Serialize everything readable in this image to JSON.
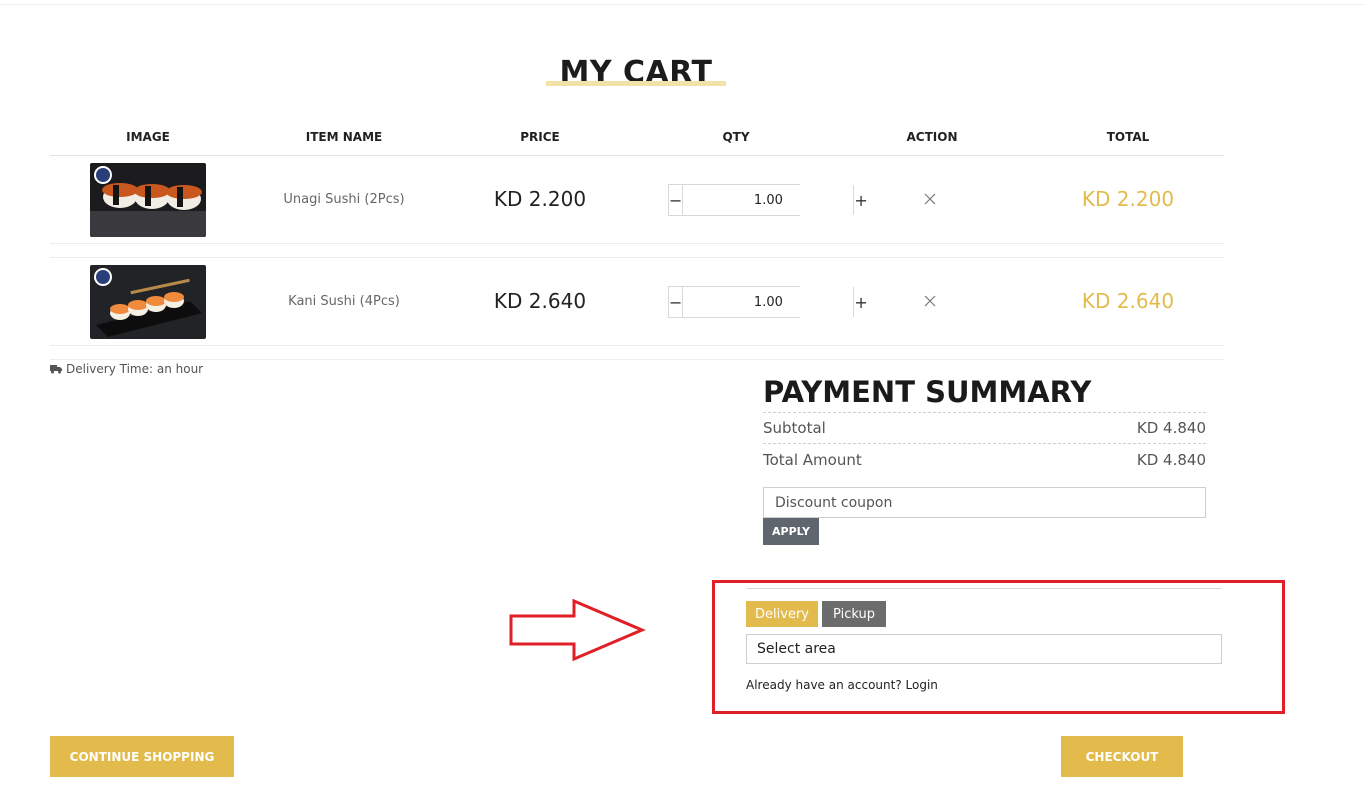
{
  "page_title": "MY CART",
  "table": {
    "headers": [
      "IMAGE",
      "ITEM NAME",
      "PRICE",
      "QTY",
      "ACTION",
      "TOTAL"
    ],
    "rows": [
      {
        "image": "unagi-sushi-photo",
        "name": "Unagi Sushi (2Pcs)",
        "price": "KD 2.200",
        "qty": "1.00",
        "total": "KD 2.200"
      },
      {
        "image": "kani-sushi-photo",
        "name": "Kani Sushi (4Pcs)",
        "price": "KD 2.640",
        "qty": "1.00",
        "total": "KD 2.640"
      }
    ],
    "minus_symbol": "−",
    "plus_symbol": "+"
  },
  "delivery_time": "Delivery Time: an hour",
  "summary": {
    "title": "PAYMENT SUMMARY",
    "subtotal_label": "Subtotal",
    "subtotal_value": "KD 4.840",
    "total_label": "Total Amount",
    "total_value": "KD 4.840",
    "coupon_placeholder": "Discount coupon",
    "apply_label": "APPLY"
  },
  "fulfilment": {
    "tabs": [
      "Delivery",
      "Pickup"
    ],
    "active_tab": "Delivery",
    "area_placeholder": "Select area",
    "account_prompt": "Already have an account?",
    "login_label": "Login"
  },
  "buttons": {
    "continue_label": "CONTINUE SHOPPING",
    "checkout_label": "CHECKOUT"
  },
  "colors": {
    "accent_gold": "#e2bb4c",
    "dark_gray": "#60666d",
    "annotation_red": "#e01f26"
  },
  "icons": [
    "truck-icon",
    "remove-x-icon",
    "red-arrow-annotation"
  ]
}
